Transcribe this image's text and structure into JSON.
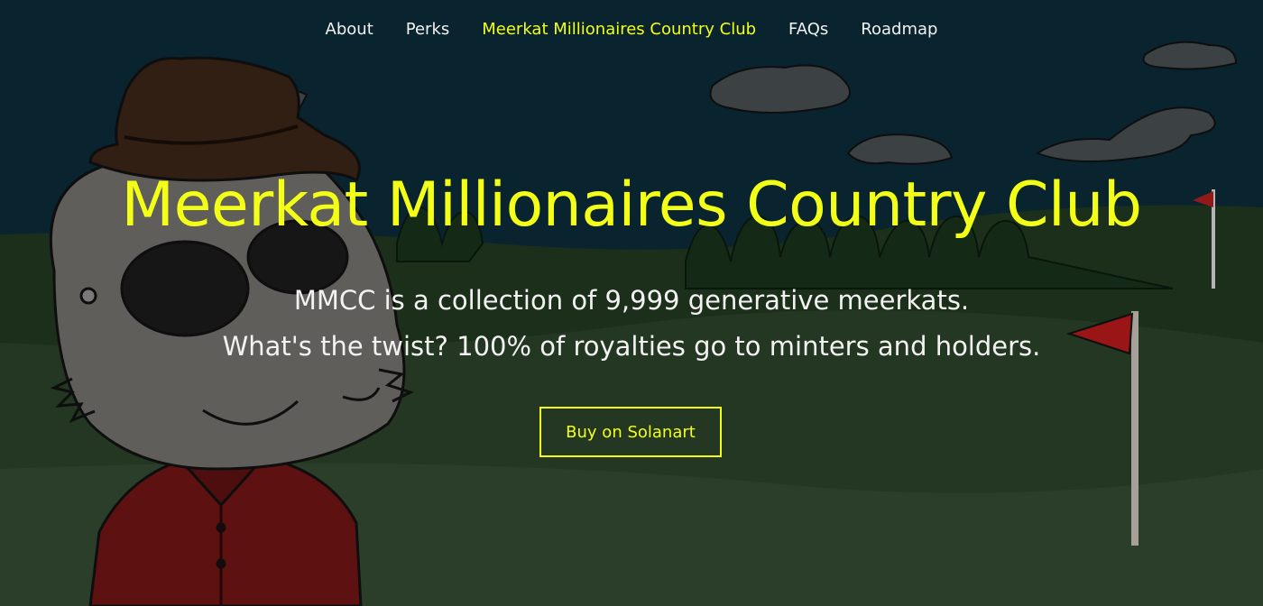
{
  "nav": {
    "items": [
      {
        "label": "About",
        "active": false
      },
      {
        "label": "Perks",
        "active": false
      },
      {
        "label": "Meerkat Millionaires Country Club",
        "active": true
      },
      {
        "label": "FAQs",
        "active": false
      },
      {
        "label": "Roadmap",
        "active": false
      }
    ]
  },
  "hero": {
    "title": "Meerkat Millionaires Country Club",
    "tagline_line1": "MMCC is a collection of 9,999 generative meerkats.",
    "tagline_line2": "What's the twist? 100% of royalties go to minters and holders.",
    "cta_label": "Buy on Solanart"
  },
  "colors": {
    "accent": "#f3ff17",
    "text": "#f2f2f2",
    "sky": "#0d2b3a",
    "grass": "#243a22"
  }
}
